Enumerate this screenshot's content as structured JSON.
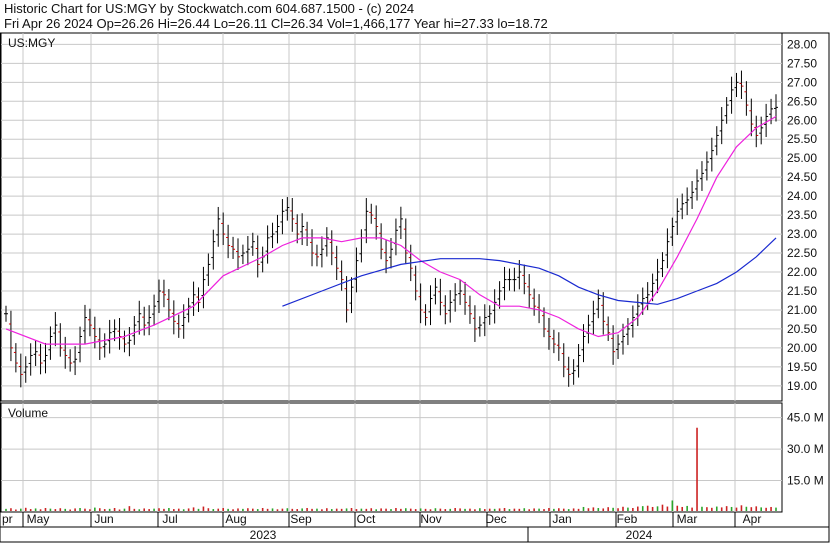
{
  "header": {
    "title": "Historic Chart for US:MGY by Stockwatch.com 604.687.1500 - (c) 2024",
    "stats": "Fri Apr 26 2024   Op=26.26  Hi=26.44  Lo=26.11  Cl=26.34  Vol=1,466,177  Year hi=27.33  lo=18.72"
  },
  "chart_data": [
    {
      "type": "ohlc",
      "title": "US:MGY",
      "y_ticks": [
        "19.00",
        "19.50",
        "20.00",
        "20.50",
        "21.00",
        "21.50",
        "22.00",
        "22.50",
        "23.00",
        "23.50",
        "24.00",
        "24.50",
        "25.00",
        "25.50",
        "26.00",
        "26.50",
        "27.00",
        "27.50",
        "28.00"
      ],
      "ylim": [
        18.6,
        28.3
      ],
      "x_months": [
        "pr",
        "May",
        "Jun",
        "Jul",
        "Aug",
        "Sep",
        "Oct",
        "Nov",
        "Dec",
        "Jan",
        "Feb",
        "Mar",
        "Apr"
      ],
      "x_years": [
        "2023",
        "2024"
      ],
      "grid": true,
      "colors": {
        "up_tick": "#000000",
        "down_tick": "#cc0000",
        "ma_short": "#ee22dd",
        "ma_long": "#1a2ad0",
        "grid": "#c8c8c8"
      },
      "price_series": {
        "name": "US:MGY",
        "x": [
          0,
          5,
          10,
          15,
          20,
          25,
          30,
          35,
          40,
          45,
          50,
          55,
          60,
          65,
          70,
          75,
          80,
          85,
          90,
          95,
          100,
          105,
          110,
          115,
          120,
          125,
          130,
          135,
          140,
          145,
          150,
          155,
          160,
          165,
          170,
          175,
          180,
          185,
          190,
          195,
          200,
          205,
          210,
          215,
          220,
          225,
          230,
          235,
          240,
          245,
          250,
          255,
          260,
          265,
          270,
          275,
          280,
          285,
          290,
          295,
          300,
          305,
          310,
          315,
          320,
          325,
          330,
          335,
          340,
          345,
          350,
          355,
          360,
          365,
          370,
          375,
          380,
          385,
          390,
          395,
          400,
          405,
          410,
          415,
          420,
          425,
          430,
          435,
          440,
          445,
          450,
          455,
          460,
          465,
          470,
          475,
          480,
          485,
          490,
          495,
          500,
          505,
          510,
          515,
          520,
          525,
          530,
          535,
          540,
          545,
          550,
          555,
          560,
          565,
          570,
          575,
          580,
          585,
          590,
          595,
          600,
          605,
          610,
          615,
          620,
          625,
          630,
          635,
          640,
          645,
          650,
          655,
          660,
          665,
          670,
          675,
          680,
          685,
          690,
          695,
          700,
          705,
          710,
          715,
          720,
          725,
          730,
          735,
          740,
          745,
          750,
          755,
          760,
          765,
          770,
          775,
          780
        ],
        "close": [
          20.9,
          20.0,
          19.6,
          19.3,
          19.5,
          19.8,
          19.9,
          19.6,
          19.8,
          20.3,
          20.6,
          20.0,
          19.8,
          19.6,
          19.7,
          20.3,
          20.8,
          20.6,
          20.3,
          20.0,
          20.1,
          20.4,
          20.5,
          20.3,
          20.1,
          20.2,
          20.6,
          20.9,
          20.6,
          20.8,
          21.1,
          21.5,
          21.4,
          21.0,
          20.7,
          20.5,
          20.8,
          21.1,
          21.4,
          21.2,
          21.8,
          22.2,
          22.8,
          23.4,
          23.0,
          22.7,
          22.6,
          22.4,
          22.5,
          22.6,
          22.8,
          22.2,
          22.4,
          22.9,
          23.0,
          23.2,
          23.6,
          23.7,
          23.4,
          23.0,
          23.2,
          22.9,
          22.5,
          22.4,
          22.6,
          22.9,
          22.5,
          22.1,
          21.8,
          21.0,
          21.6,
          22.3,
          22.9,
          23.6,
          23.5,
          23.2,
          22.6,
          22.3,
          22.6,
          23.1,
          23.4,
          22.5,
          22.1,
          21.5,
          21.0,
          20.8,
          21.3,
          21.6,
          21.2,
          20.9,
          21.2,
          21.4,
          21.5,
          21.2,
          20.9,
          20.5,
          20.6,
          20.8,
          20.9,
          21.2,
          21.5,
          21.8,
          21.8,
          21.8,
          22.0,
          21.7,
          21.4,
          21.1,
          21.0,
          20.5,
          20.3,
          20.1,
          20.0,
          19.5,
          19.3,
          19.4,
          19.8,
          20.3,
          20.6,
          20.9,
          21.3,
          20.7,
          20.4,
          19.9,
          20.1,
          20.3,
          20.5,
          20.8,
          21.1,
          21.3,
          21.4,
          21.7,
          22.0,
          22.3,
          22.8,
          23.2,
          23.6,
          23.8,
          23.9,
          24.1,
          24.4,
          24.6,
          24.9,
          25.2,
          25.6,
          26.0,
          26.4,
          26.8,
          27.0,
          26.9,
          26.4,
          25.9,
          25.6,
          25.8,
          26.1,
          26.3,
          26.34
        ],
        "high_low_spread": 0.35
      },
      "ma_short": {
        "x": [
          0,
          40,
          80,
          120,
          150,
          190,
          220,
          260,
          280,
          300,
          320,
          340,
          360,
          380,
          400,
          420,
          440,
          460,
          480,
          500,
          520,
          540,
          560,
          580,
          600,
          620,
          640,
          660,
          680,
          700,
          720,
          740,
          760,
          780
        ],
        "y": [
          20.5,
          20.1,
          20.1,
          20.3,
          20.6,
          21.1,
          21.9,
          22.4,
          22.7,
          22.9,
          22.9,
          22.8,
          22.9,
          22.9,
          22.7,
          22.3,
          22.0,
          21.8,
          21.4,
          21.1,
          21.1,
          21.0,
          20.8,
          20.5,
          20.3,
          20.4,
          20.8,
          21.5,
          22.4,
          23.4,
          24.5,
          25.3,
          25.8,
          26.1
        ]
      },
      "ma_long": {
        "x": [
          280,
          320,
          360,
          400,
          440,
          480,
          500,
          520,
          540,
          560,
          580,
          600,
          620,
          640,
          660,
          680,
          700,
          720,
          740,
          760,
          780
        ],
        "y": [
          21.1,
          21.5,
          21.9,
          22.2,
          22.35,
          22.35,
          22.3,
          22.2,
          22.1,
          21.9,
          21.6,
          21.4,
          21.25,
          21.2,
          21.15,
          21.3,
          21.5,
          21.7,
          22.0,
          22.4,
          22.9
        ]
      }
    },
    {
      "type": "bar",
      "title": "Volume",
      "y_ticks": [
        "15.0 M",
        "30.0 M",
        "45.0 M"
      ],
      "ylim": [
        0,
        52
      ],
      "unit": "M",
      "values_note_none": "",
      "x": [
        0,
        5,
        10,
        15,
        20,
        25,
        30,
        35,
        40,
        45,
        50,
        55,
        60,
        65,
        70,
        75,
        80,
        85,
        90,
        95,
        100,
        105,
        110,
        115,
        120,
        125,
        130,
        135,
        140,
        145,
        150,
        155,
        160,
        165,
        170,
        175,
        180,
        185,
        190,
        195,
        200,
        205,
        210,
        215,
        220,
        225,
        230,
        235,
        240,
        245,
        250,
        255,
        260,
        265,
        270,
        275,
        280,
        285,
        290,
        295,
        300,
        305,
        310,
        315,
        320,
        325,
        330,
        335,
        340,
        345,
        350,
        355,
        360,
        365,
        370,
        375,
        380,
        385,
        390,
        395,
        400,
        405,
        410,
        415,
        420,
        425,
        430,
        435,
        440,
        445,
        450,
        455,
        460,
        465,
        470,
        475,
        480,
        485,
        490,
        495,
        500,
        505,
        510,
        515,
        520,
        525,
        530,
        535,
        540,
        545,
        550,
        555,
        560,
        565,
        570,
        575,
        580,
        585,
        590,
        595,
        600,
        605,
        610,
        615,
        620,
        625,
        630,
        635,
        640,
        645,
        650,
        655,
        660,
        665,
        670,
        675,
        680,
        685,
        690,
        695,
        700,
        705,
        710,
        715,
        720,
        725,
        730,
        735,
        740,
        745,
        750,
        755,
        760,
        765,
        770,
        775,
        780
      ],
      "values": [
        1.5,
        1.8,
        1.2,
        1.6,
        2.0,
        1.4,
        1.7,
        1.3,
        1.9,
        1.6,
        1.4,
        1.8,
        1.5,
        1.2,
        1.7,
        1.9,
        1.6,
        1.3,
        2.1,
        1.8,
        1.4,
        1.5,
        1.9,
        1.2,
        1.6,
        2.8,
        1.5,
        1.3,
        1.7,
        1.4,
        1.6,
        1.8,
        1.5,
        1.9,
        1.4,
        1.6,
        1.3,
        1.7,
        2.2,
        1.5,
        2.6,
        1.8,
        1.4,
        1.6,
        1.9,
        1.5,
        1.3,
        1.7,
        1.5,
        1.8,
        1.6,
        1.4,
        1.9,
        1.5,
        1.7,
        1.3,
        1.6,
        1.8,
        1.5,
        1.4,
        1.7,
        1.9,
        1.5,
        1.6,
        1.3,
        1.8,
        1.4,
        1.6,
        1.5,
        1.7,
        1.9,
        1.4,
        1.6,
        1.5,
        1.8,
        1.3,
        1.7,
        1.6,
        1.4,
        1.9,
        1.5,
        1.8,
        1.6,
        1.4,
        1.7,
        1.5,
        1.3,
        1.8,
        1.6,
        1.4,
        1.5,
        1.9,
        1.7,
        1.5,
        1.6,
        1.3,
        1.8,
        1.4,
        1.6,
        1.5,
        1.7,
        1.9,
        1.4,
        1.6,
        1.5,
        1.8,
        1.3,
        1.7,
        1.6,
        1.4,
        1.9,
        1.5,
        1.8,
        1.6,
        1.4,
        1.7,
        1.5,
        2.4,
        1.8,
        2.2,
        1.9,
        1.7,
        2.3,
        2.0,
        1.8,
        2.5,
        2.1,
        1.9,
        2.6,
        2.8,
        3.0,
        2.4,
        2.7,
        3.5,
        2.6,
        5.5,
        3.0,
        2.4,
        2.9,
        2.1,
        40.2,
        2.5,
        2.3,
        2.0,
        2.6,
        2.2,
        2.8,
        2.4,
        2.1,
        3.2,
        2.5,
        2.3,
        2.7,
        2.2,
        2.0,
        2.4,
        2.1,
        2.3,
        2.0
      ],
      "spike": {
        "x": 688,
        "value": 40.2
      }
    }
  ]
}
